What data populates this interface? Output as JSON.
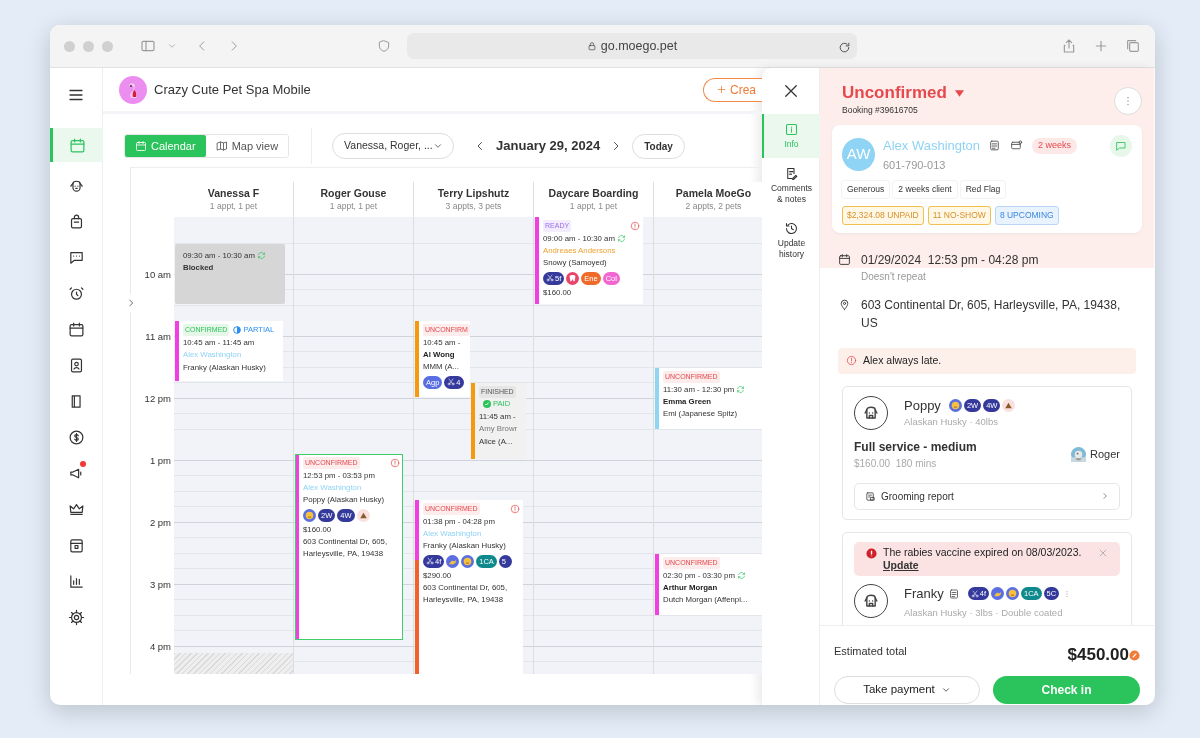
{
  "browser": {
    "url": "go.moego.pet"
  },
  "sidebar": {
    "items": [
      {
        "selected": true,
        "notification": false
      },
      {
        "selected": false,
        "notification": false
      },
      {
        "selected": false,
        "notification": false
      },
      {
        "selected": false,
        "notification": false
      },
      {
        "selected": false,
        "notification": false
      },
      {
        "selected": false,
        "notification": false
      },
      {
        "selected": false,
        "notification": false
      },
      {
        "selected": false,
        "notification": false
      },
      {
        "selected": false,
        "notification": false
      },
      {
        "selected": false,
        "notification": true
      },
      {
        "selected": false,
        "notification": false
      },
      {
        "selected": false,
        "notification": false
      },
      {
        "selected": false,
        "notification": false
      },
      {
        "selected": false,
        "notification": false
      }
    ]
  },
  "business": {
    "name": "Crazy Cute Pet Spa Mobile"
  },
  "create_button": {
    "label": "Crea"
  },
  "view_toggle": [
    {
      "label": "Calendar",
      "selected": true
    },
    {
      "label": "Map view",
      "selected": false
    }
  ],
  "staff_filter": {
    "value": "Vanessa, Roger, ..."
  },
  "date": "January 29, 2024",
  "today_button": "Today",
  "calendar": {
    "hours": [
      "10 am",
      "11 am",
      "12 pm",
      "1 pm",
      "2 pm",
      "3 pm",
      "4 pm"
    ],
    "columns": [
      {
        "name": "Vanessa F",
        "summary": "1 appt, 1 pet",
        "events": [
          {
            "kind": "blocked",
            "selected": false,
            "time": "09:30 am - 10:30 am",
            "title": "Blocked",
            "repeat": true
          },
          {
            "kind": "appointment",
            "selected": false,
            "status": {
              "label": "CONFIRMED",
              "kind": "confirmed"
            },
            "payment": {
              "label": "PARTIAL",
              "kind": "partial"
            },
            "alert": false,
            "repeat": false,
            "time": "10:45 am - 11:45 am",
            "client": {
              "name": "Alex Washington",
              "kind": "linked"
            },
            "pet": "Franky (Alaskan Husky)",
            "bar": [
              {
                "color": "#f13fe0"
              }
            ]
          },
          {
            "kind": "unavailable"
          }
        ]
      },
      {
        "name": "Roger Gouse",
        "summary": "1 appt, 1 pet",
        "events": [
          {
            "kind": "appointment",
            "selected": true,
            "status": {
              "label": "UNCONFIRMED",
              "kind": "unconfirmed"
            },
            "alert": true,
            "repeat": false,
            "time": "12:53 pm - 03:53 pm",
            "client": {
              "name": "Alex Washington",
              "kind": "linked"
            },
            "pet": "Poppy (Alaskan Husky)",
            "tags": [
              {
                "kind": "face"
              },
              {
                "kind": "text",
                "label": "2W",
                "color": "#34399b"
              },
              {
                "kind": "text",
                "label": "4W",
                "color": "#34399b"
              },
              {
                "kind": "poop"
              }
            ],
            "price": "$160.00",
            "address": "603 Continental Dr, 605, Harleysville, PA, 19438",
            "bar": [
              {
                "color": "#f13fe0"
              }
            ]
          }
        ]
      },
      {
        "name": "Terry Lipshutz",
        "summary": "3 appts, 3 pets",
        "events": [
          {
            "kind": "appointment",
            "selected": false,
            "status": {
              "label": "UNCONFIRM",
              "kind": "unconfirmed"
            },
            "alert": false,
            "repeat": false,
            "time": "10:45 am -",
            "client": {
              "name": "Al Wong",
              "kind": "plain"
            },
            "pet": "MMM (A...",
            "tags": [
              {
                "kind": "text",
                "label": "Agp",
                "color": "#5a6ee3"
              },
              {
                "kind": "groom",
                "label": "4"
              }
            ],
            "bar": [
              {
                "color": "#f59a0c"
              }
            ]
          },
          {
            "kind": "appointment",
            "selected": false,
            "status": {
              "label": "FINISHED",
              "kind": "finished"
            },
            "payment": {
              "label": "PAID",
              "kind": "paid"
            },
            "alert": false,
            "repeat": false,
            "time": "11:45 am -",
            "client": {
              "name": "Amy Browr",
              "kind": "muted"
            },
            "pet": "Alice (A...",
            "bar": [
              {
                "color": "#f59a0c"
              }
            ]
          },
          {
            "kind": "appointment",
            "selected": false,
            "status": {
              "label": "UNCONFIRMED",
              "kind": "unconfirmed"
            },
            "alert": true,
            "repeat": false,
            "time": "01:38 pm - 04:28 pm",
            "client": {
              "name": "Alex Washington",
              "kind": "linked"
            },
            "pet": "Franky (Alaskan Husky)",
            "tags": [
              {
                "kind": "groom",
                "label": "4f"
              },
              {
                "kind": "hand"
              },
              {
                "kind": "face"
              },
              {
                "kind": "text",
                "label": "1CA",
                "color": "#0e8a8c"
              },
              {
                "kind": "text",
                "label": "5",
                "color": "#34399b"
              }
            ],
            "price": "$290.00",
            "address": "603 Continental Dr, 605, Harleysville, PA, 19438",
            "bar": [
              {
                "color": "#f13fe0"
              },
              {
                "color": "#f2602e"
              }
            ]
          }
        ]
      },
      {
        "name": "Daycare Boarding",
        "summary": "1 appt, 1 pet",
        "events": [
          {
            "kind": "appointment",
            "selected": false,
            "status": {
              "label": "READY",
              "kind": "ready"
            },
            "alert": true,
            "repeat": true,
            "time": "09:00 am - 10:30 am",
            "client": {
              "name": "Andreaes Andersons",
              "kind": "highlight"
            },
            "pet": "Snowy (Samoyed)",
            "tags": [
              {
                "kind": "groom",
                "label": "5f"
              },
              {
                "kind": "tooth"
              },
              {
                "kind": "text",
                "label": "Ene",
                "color": "#f06a2a"
              },
              {
                "kind": "text",
                "label": "Col",
                "color": "#f266cf"
              }
            ],
            "price": "$160.00",
            "bar": [
              {
                "color": "#f13fe0"
              }
            ]
          }
        ]
      },
      {
        "name": "Pamela MoeGo",
        "summary": "2 appts, 2 pets",
        "events": [
          {
            "kind": "appointment",
            "selected": false,
            "status": {
              "label": "UNCONFIRMED",
              "kind": "unconfirmed"
            },
            "alert": false,
            "repeat": true,
            "time": "11:30 am - 12:30 pm",
            "client": {
              "name": "Emma Green",
              "kind": "plain"
            },
            "pet": "Emi (Japanese Spitz)",
            "bar": [
              {
                "color": "#8fd6f5"
              }
            ]
          },
          {
            "kind": "appointment",
            "selected": false,
            "status": {
              "label": "UNCONFIRMED",
              "kind": "unconfirmed"
            },
            "alert": false,
            "repeat": true,
            "time": "02:30 pm - 03:30 pm",
            "client": {
              "name": "Arthur Morgan",
              "kind": "plain"
            },
            "pet": "Dutch Morgan (Affenpi...",
            "bar": [
              {
                "color": "#f13fe0"
              }
            ]
          }
        ]
      }
    ]
  },
  "drawer": {
    "tabs": [
      {
        "label": "Info",
        "selected": true
      },
      {
        "label": "Comments & notes",
        "selected": false
      },
      {
        "label": "Update history",
        "selected": false
      }
    ],
    "status": "Unconfirmed",
    "booking": "Booking #39616705",
    "client": {
      "initials": "AW",
      "name": "Alex Washington",
      "badge": "2 weeks",
      "phone": "601-790-013",
      "tags": [
        "Generous",
        "2 weeks client",
        "Red Flag"
      ],
      "stats": [
        {
          "label": "$2,324.08 UNPAID",
          "kind": "warning"
        },
        {
          "label": "11 NO-SHOW",
          "kind": "warning"
        },
        {
          "label": "8 UPCOMING",
          "kind": "info"
        }
      ]
    },
    "schedule": {
      "date": "01/29/2024",
      "time": "12:53 pm - 04:28 pm",
      "repeat": "Doesn't repeat"
    },
    "address": "603 Continental Dr, 605, Harleysville, PA, 19438, US",
    "note": "Alex always late.",
    "pets": [
      {
        "name": "Poppy",
        "notes": false,
        "tags": [
          {
            "kind": "face"
          },
          {
            "kind": "text",
            "label": "2W",
            "color": "#34399b"
          },
          {
            "kind": "text",
            "label": "4W",
            "color": "#34399b"
          },
          {
            "kind": "poop"
          }
        ],
        "breed": "Alaskan Husky · 40lbs",
        "service": "Full service - medium",
        "price": "$160.00",
        "duration": "180 mins",
        "staff": "Roger",
        "report": "Grooming report"
      },
      {
        "name": "Franky",
        "notes": true,
        "warning": {
          "text": "The rabies vaccine expired on 08/03/2023.",
          "link": "Update"
        },
        "tags": [
          {
            "kind": "groom",
            "label": "4f"
          },
          {
            "kind": "hand"
          },
          {
            "kind": "face"
          },
          {
            "kind": "text",
            "label": "1CA",
            "color": "#0e8a8c"
          },
          {
            "kind": "text",
            "label": "5C",
            "color": "#34399b"
          }
        ],
        "breed": "Alaskan Husky · 3lbs · Double coated"
      }
    ],
    "total_label": "Estimated total",
    "total": "$450.00",
    "payment_button": "Take payment",
    "checkin_button": "Check in"
  }
}
